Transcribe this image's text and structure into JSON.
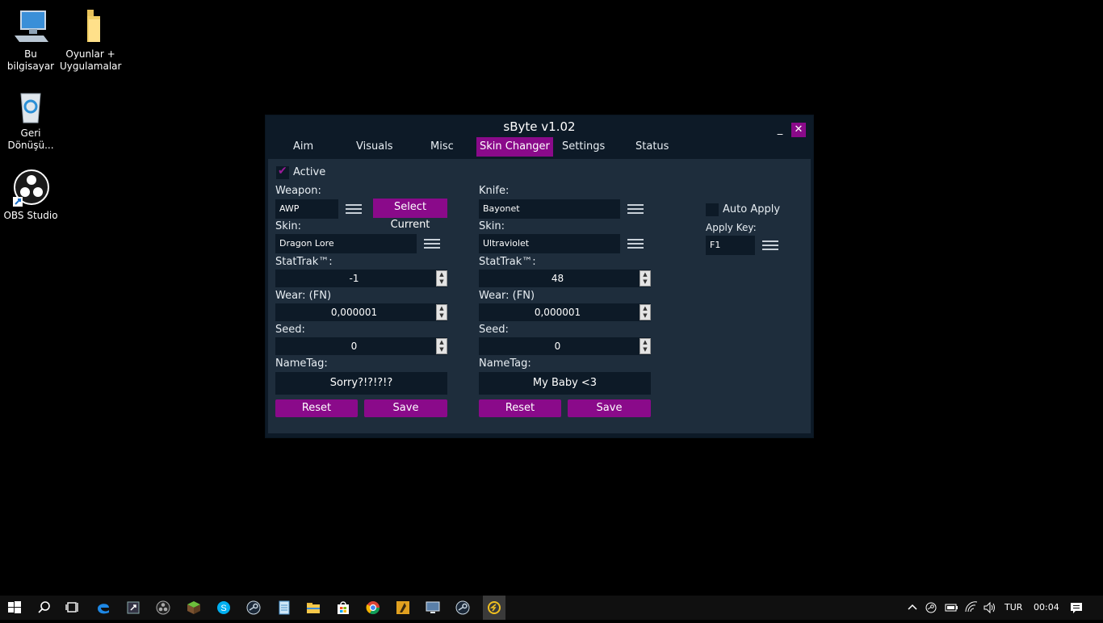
{
  "desktop": {
    "icons": [
      {
        "label": "Bu bilgisayar",
        "icon": "computer-icon"
      },
      {
        "label": "Oyunlar + Uygulamalar",
        "icon": "folder-icon"
      },
      {
        "label": "Geri Dönüşü...",
        "icon": "recycle-bin-icon"
      },
      {
        "label": "OBS Studio",
        "icon": "obs-icon"
      }
    ]
  },
  "window": {
    "title": "sByte v1.02",
    "minimize": "_",
    "close": "✕",
    "tabs": [
      "Aim",
      "Visuals",
      "Misc",
      "Skin Changer",
      "Settings",
      "Status"
    ],
    "active_tab": "Skin Changer",
    "accent_color": "#8a0a8a"
  },
  "skin_changer": {
    "active_label": "Active",
    "active_checked": true,
    "weapon": {
      "label": "Weapon:",
      "value": "AWP",
      "select_current": "Select Current",
      "skin_label": "Skin:",
      "skin_value": "Dragon Lore",
      "stattrak_label": "StatTrak™:",
      "stattrak_value": "-1",
      "wear_label": "Wear: (FN)",
      "wear_value": "0,000001",
      "seed_label": "Seed:",
      "seed_value": "0",
      "nametag_label": "NameTag:",
      "nametag_value": "Sorry?!?!?!?",
      "reset": "Reset",
      "save": "Save"
    },
    "knife": {
      "label": "Knife:",
      "value": "Bayonet",
      "skin_label": "Skin:",
      "skin_value": "Ultraviolet",
      "stattrak_label": "StatTrak™:",
      "stattrak_value": "48",
      "wear_label": "Wear: (FN)",
      "wear_value": "0,000001",
      "seed_label": "Seed:",
      "seed_value": "0",
      "nametag_label": "NameTag:",
      "nametag_value": "My Baby <3",
      "reset": "Reset",
      "save": "Save"
    },
    "auto_apply": {
      "label": "Auto Apply",
      "checked": false,
      "apply_key_label": "Apply Key:",
      "apply_key_value": "F1"
    }
  },
  "taskbar": {
    "language": "TUR",
    "time": "00:04",
    "icons": [
      "windows-start-icon",
      "search-icon",
      "task-view-icon",
      "edge-icon",
      "app-icon",
      "obs-icon",
      "minecraft-icon",
      "skype-icon",
      "steam-icon",
      "notepad-icon",
      "file-explorer-icon",
      "store-icon",
      "chrome-icon",
      "game-icon",
      "remote-desktop-icon",
      "steam-icon",
      "sbyte-icon"
    ]
  }
}
